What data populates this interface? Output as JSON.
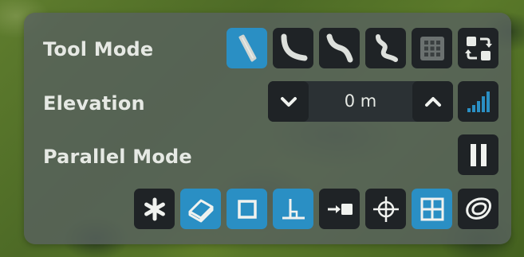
{
  "panel": {
    "tool_mode_label": "Tool Mode",
    "elevation_label": "Elevation",
    "parallel_mode_label": "Parallel Mode"
  },
  "tool_mode": {
    "buttons": [
      {
        "icon": "straight-road-icon",
        "active": true
      },
      {
        "icon": "curved-road-icon",
        "active": false
      },
      {
        "icon": "s-curve-road-icon",
        "active": false
      },
      {
        "icon": "double-curve-road-icon",
        "active": false
      },
      {
        "icon": "grid-icon",
        "active": false
      },
      {
        "icon": "replace-icon",
        "active": false
      }
    ]
  },
  "elevation": {
    "value": "0 m",
    "down_icon": "chevron-down-icon",
    "up_icon": "chevron-up-icon",
    "step_icon": "elevation-step-icon"
  },
  "parallel_mode": {
    "toggle_icon": "parallel-lines-icon"
  },
  "snapping": {
    "buttons": [
      {
        "icon": "asterisk-icon",
        "active": false
      },
      {
        "icon": "eraser-icon",
        "active": true
      },
      {
        "icon": "square-icon",
        "active": true
      },
      {
        "icon": "perpendicular-icon",
        "active": true
      },
      {
        "icon": "snap-to-end-icon",
        "active": false
      },
      {
        "icon": "crosshair-icon",
        "active": false
      },
      {
        "icon": "grid-snap-icon",
        "active": true
      },
      {
        "icon": "contour-icon",
        "active": false
      }
    ]
  },
  "colors": {
    "panel": "#58625e",
    "button": "#1f2326",
    "active": "#2a8fc4",
    "text": "#e6e9e4"
  }
}
